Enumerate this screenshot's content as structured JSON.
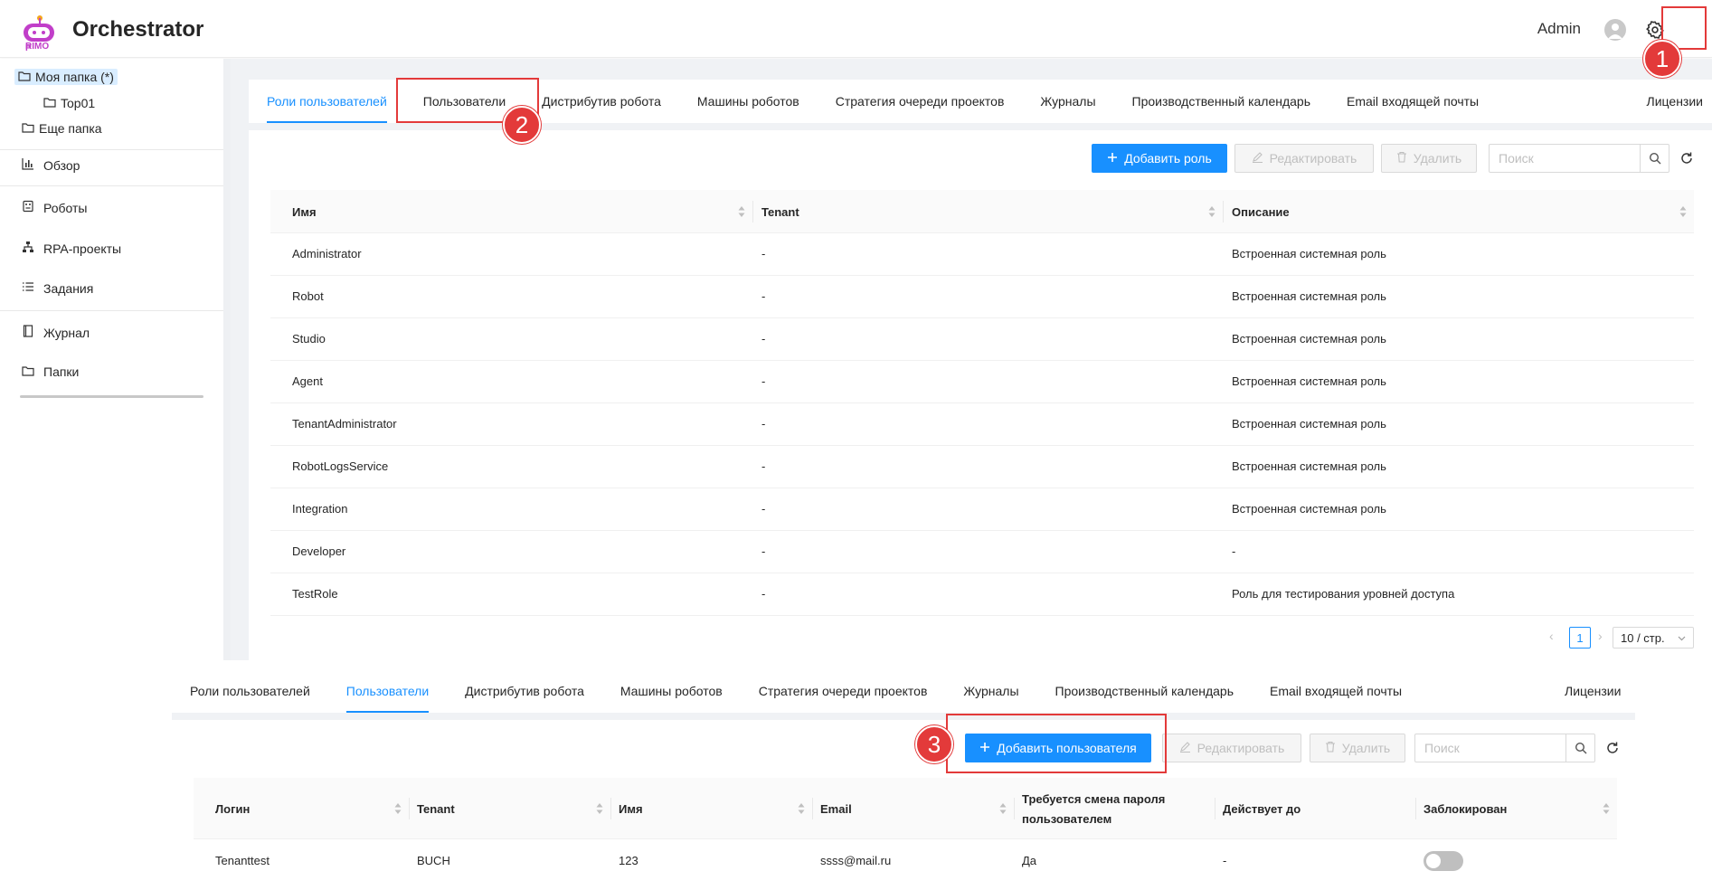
{
  "header": {
    "app_title": "Orchestrator",
    "logo_text": "RIMO",
    "user_name": "Admin"
  },
  "sidebar": {
    "tree": [
      {
        "label": "Моя папка (*)"
      },
      {
        "label": "Top01"
      },
      {
        "label": "Еще папка"
      }
    ],
    "nav": [
      {
        "label": "Обзор",
        "icon": "bar-chart-icon"
      },
      {
        "label": "Роботы",
        "icon": "robot-icon"
      },
      {
        "label": "RPA-проекты",
        "icon": "hierarchy-icon"
      },
      {
        "label": "Задания",
        "icon": "list-icon"
      },
      {
        "label": "Журнал",
        "icon": "book-icon"
      },
      {
        "label": "Папки",
        "icon": "folder-icon"
      }
    ]
  },
  "tabs": [
    "Роли пользователей",
    "Пользователи",
    "Дистрибутив робота",
    "Машины роботов",
    "Стратегия очереди проектов",
    "Журналы",
    "Производственный календарь",
    "Email входящей почты",
    "Лицензии"
  ],
  "roles_panel": {
    "add_label": "Добавить роль",
    "edit_label": "Редактировать",
    "delete_label": "Удалить",
    "search_placeholder": "Поиск",
    "columns": [
      "Имя",
      "Tenant",
      "Описание"
    ],
    "rows": [
      [
        "Administrator",
        "-",
        "Встроенная системная роль"
      ],
      [
        "Robot",
        "-",
        "Встроенная системная роль"
      ],
      [
        "Studio",
        "-",
        "Встроенная системная роль"
      ],
      [
        "Agent",
        "-",
        "Встроенная системная роль"
      ],
      [
        "TenantAdministrator",
        "-",
        "Встроенная системная роль"
      ],
      [
        "RobotLogsService",
        "-",
        "Встроенная системная роль"
      ],
      [
        "Integration",
        "-",
        "Встроенная системная роль"
      ],
      [
        "Developer",
        "-",
        "-"
      ],
      [
        "TestRole",
        "-",
        "Роль для тестирования уровней доступа"
      ]
    ],
    "pager": {
      "page": "1",
      "size": "10 / стр."
    }
  },
  "users_panel": {
    "add_label": "Добавить пользователя",
    "edit_label": "Редактировать",
    "delete_label": "Удалить",
    "search_placeholder": "Поиск",
    "columns": [
      "Логин",
      "Tenant",
      "Имя",
      "Email",
      "Требуется смена пароля пользователем",
      "Действует до",
      "Заблокирован"
    ],
    "col_pw_line1": "Требуется смена пароля",
    "col_pw_line2": "пользователем",
    "rows": [
      {
        "login": "Tenanttest",
        "tenant": "BUCH",
        "name": "123",
        "email": "ssss@mail.ru",
        "pw": "Да",
        "until": "-",
        "blocked": false
      }
    ]
  },
  "annotations": [
    "1",
    "2",
    "3"
  ],
  "colors": {
    "accent": "#1890ff",
    "annotation": "#e33a3a",
    "logo": "#c13ec9"
  }
}
